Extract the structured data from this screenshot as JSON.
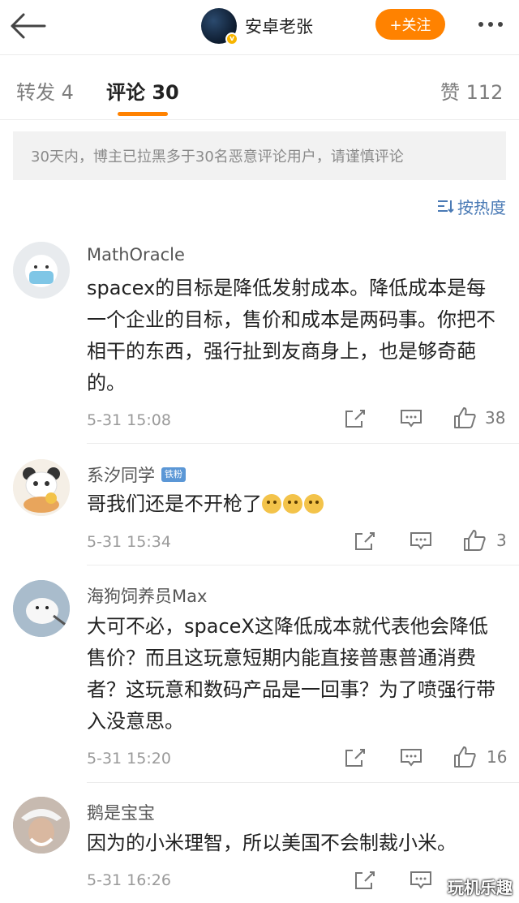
{
  "header": {
    "author_name": "安卓老张",
    "follow_label": "+关注"
  },
  "tabs": [
    {
      "label": "转发 4"
    },
    {
      "label": "评论 30"
    },
    {
      "label": "赞 112"
    }
  ],
  "notice": "30天内，博主已拉黑多于30名恶意评论用户，请谨慎评论",
  "sort_label": "按热度",
  "comments": [
    {
      "name": "MathOracle",
      "text": "spacex的目标是降低发射成本。降低成本是每一个企业的目标，售价和成本是两码事。你把不相干的东西，强行扯到友商身上，也是够奇葩的。",
      "time": "5-31 15:08",
      "likes": "38"
    },
    {
      "name": "系汐同学",
      "badge": "铁粉",
      "text": "哥我们还是不开枪了",
      "time": "5-31 15:34",
      "likes": "3"
    },
    {
      "name": "海狗饲养员Max",
      "text": "大可不必，spaceX这降低成本就代表他会降低售价？而且这玩意短期内能直接普惠普通消费者？这玩意和数码产品是一回事？为了喷强行带入没意思。",
      "time": "5-31 15:20",
      "likes": "16"
    },
    {
      "name": "鹅是宝宝",
      "text": "因为的小米理智，所以美国不会制裁小米。",
      "time": "5-31 16:26",
      "likes": ""
    }
  ],
  "watermark": "玩机乐趣",
  "colors": {
    "accent": "#ff8200",
    "link": "#4a7ab5"
  }
}
